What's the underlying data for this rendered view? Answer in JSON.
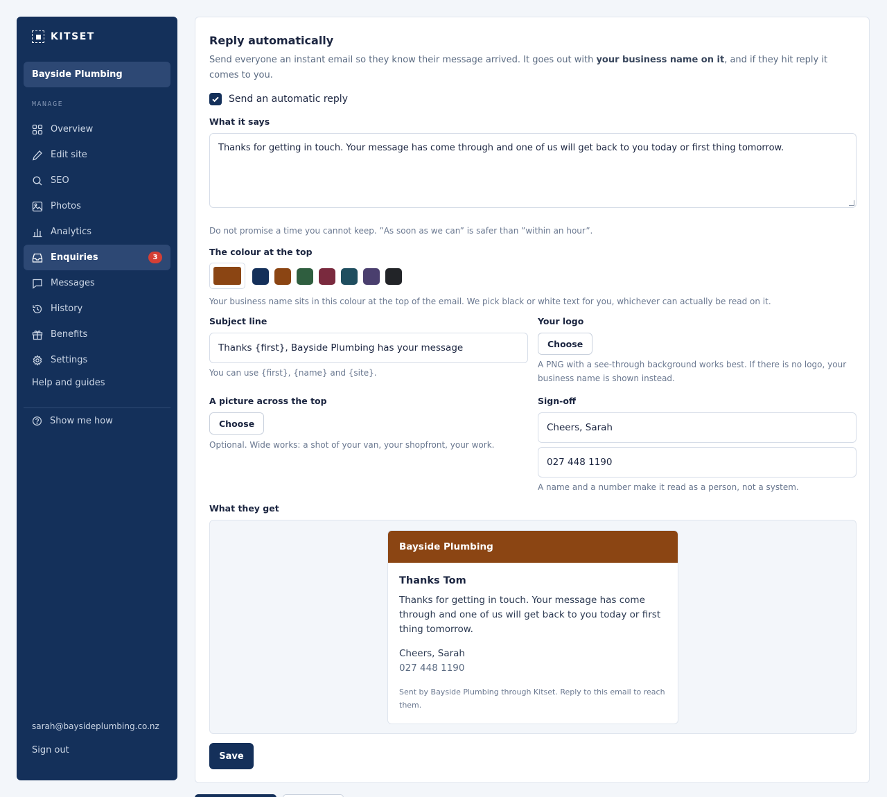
{
  "sidebar": {
    "brand": "KITSET",
    "site_name": "Bayside Plumbing",
    "section_label": "MANAGE",
    "items": [
      {
        "label": "Overview",
        "icon": "grid-icon"
      },
      {
        "label": "Edit site",
        "icon": "pencil-icon"
      },
      {
        "label": "SEO",
        "icon": "search-icon"
      },
      {
        "label": "Photos",
        "icon": "image-icon"
      },
      {
        "label": "Analytics",
        "icon": "bar-chart-icon"
      },
      {
        "label": "Enquiries",
        "icon": "inbox-icon",
        "active": true,
        "badge": "3"
      },
      {
        "label": "Messages",
        "icon": "chat-icon"
      },
      {
        "label": "History",
        "icon": "history-icon"
      },
      {
        "label": "Benefits",
        "icon": "gift-icon"
      },
      {
        "label": "Settings",
        "icon": "gear-icon"
      }
    ],
    "help": "Help and guides",
    "show_me_how": "Show me how",
    "user_email": "sarah@baysideplumbing.co.nz",
    "sign_out": "Sign out"
  },
  "form": {
    "title": "Reply automatically",
    "intro_before": "Send everyone an instant email so they know their message arrived. It goes out with ",
    "intro_bold": "your business name on it",
    "intro_after": ", and if they hit reply it comes to you.",
    "auto_reply_label": "Send an automatic reply",
    "auto_reply_checked": true,
    "message_label": "What it says",
    "message_value": "Thanks for getting in touch. Your message has come through and one of us will get back to you today or first thing tomorrow.",
    "message_hint": "Do not promise a time you cannot keep. ”As soon as we can” is safer than ”within an hour”.",
    "colour_label": "The colour at the top",
    "selected_colour": "#8b4513",
    "colour_options": [
      "#14305a",
      "#8b4513",
      "#2f5e3f",
      "#7a2a3e",
      "#1f4e5f",
      "#4a3f6e",
      "#222428"
    ],
    "colour_hint": "Your business name sits in this colour at the top of the email. We pick black or white text for you, whichever can actually be read on it.",
    "subject_label": "Subject line",
    "subject_value": "Thanks {first}, Bayside Plumbing has your message",
    "subject_hint": "You can use {first}, {name} and {site}.",
    "logo_label": "Your logo",
    "logo_button": "Choose",
    "logo_hint": "A PNG with a see-through background works best. If there is no logo, your business name is shown instead.",
    "picture_label": "A picture across the top",
    "picture_button": "Choose",
    "picture_hint": "Optional. Wide works: a shot of your van, your shopfront, your work.",
    "signoff_label": "Sign-off",
    "signoff_name": "Cheers, Sarah",
    "signoff_phone": "027 448 1190",
    "signoff_hint": "A name and a number make it read as a person, not a system.",
    "preview_label": "What they get",
    "save_label": "Save"
  },
  "preview": {
    "header": "Bayside Plumbing",
    "greeting": "Thanks Tom",
    "message": "Thanks for getting in touch. Your message has come through and one of us will get back to you today or first thing tomorrow.",
    "signoff": "Cheers, Sarah",
    "phone": "027 448 1190",
    "footer": "Sent by Bayside Plumbing through Kitset. Reply to this email to reach them."
  }
}
